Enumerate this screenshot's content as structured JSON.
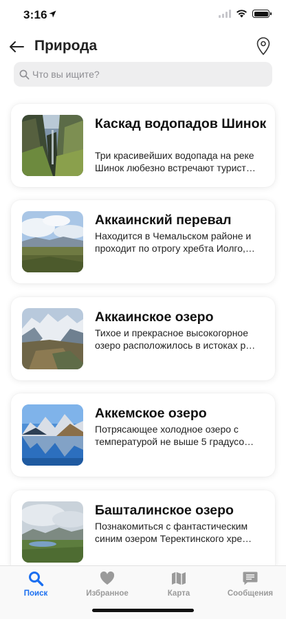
{
  "status": {
    "time": "3:16"
  },
  "header": {
    "title": "Природа"
  },
  "search": {
    "placeholder": "Что вы ищите?"
  },
  "cards": [
    {
      "title": "Каскад водопадов Шинок",
      "description": "Три красивейших водопада на реке Шинок любезно встречают турист…"
    },
    {
      "title": "Аккаинский перевал",
      "description": "Находится в Чемальском районе и проходит по отрогу хребта Иолго,…"
    },
    {
      "title": "Аккаинское озеро",
      "description": "Тихое и прекрасное высокогорное озеро расположилось в истоках р…"
    },
    {
      "title": "Аккемское озеро",
      "description": "Потрясающее холодное озеро с температурой не выше 5 градусо…"
    },
    {
      "title": "Башталинское озеро",
      "description": "Познакомиться с фантастическим синим озером Теректинского хре…"
    }
  ],
  "tabbar": {
    "tabs": [
      {
        "label": "Поиск",
        "icon": "search-icon",
        "active": true
      },
      {
        "label": "Избранное",
        "icon": "heart-icon",
        "active": false
      },
      {
        "label": "Карта",
        "icon": "map-icon",
        "active": false
      },
      {
        "label": "Сообщения",
        "icon": "message-icon",
        "active": false
      }
    ]
  },
  "colors": {
    "accent": "#1b6ff0",
    "inactive": "#9a9a9a"
  }
}
